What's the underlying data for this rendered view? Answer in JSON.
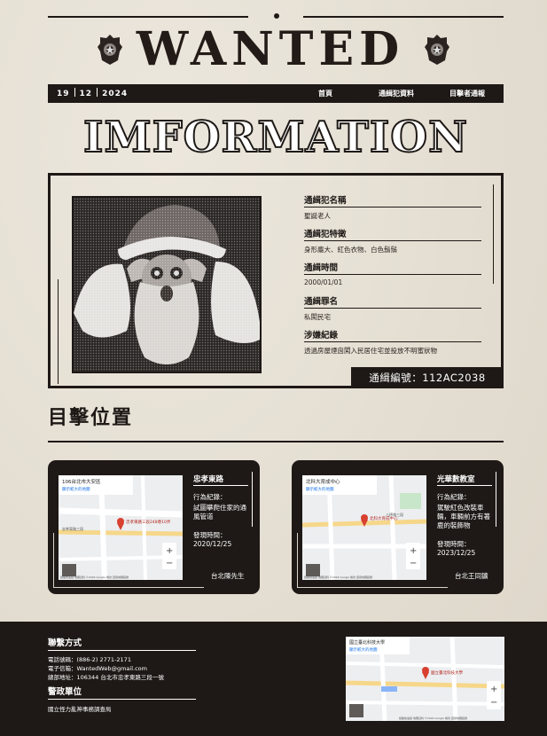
{
  "header": {
    "title": "WANTED",
    "date": {
      "day": "19",
      "month": "12",
      "year": "2024"
    },
    "nav": [
      {
        "label": "首頁"
      },
      {
        "label": "通緝犯資料"
      },
      {
        "label": "目擊者通報"
      }
    ],
    "banner": "IMFORMATION"
  },
  "profile": {
    "fields": [
      {
        "label": "通緝犯名稱",
        "value": "聖誕老人"
      },
      {
        "label": "通緝犯特徵",
        "value": "身形龐大、紅色衣物、白色鬍鬚"
      },
      {
        "label": "通緝時間",
        "value": "2000/01/01"
      },
      {
        "label": "通緝罪名",
        "value": "私闖民宅"
      },
      {
        "label": "涉嫌紀錄",
        "value": "透過房屋煙囪闖入民居住宅並投放不明蜜狀物"
      }
    ],
    "wanted_number": "通緝編號：112AC2038"
  },
  "sightings": {
    "title": "目擊位置",
    "cards": [
      {
        "location": "忠孝東路",
        "record_label": "行為紀錄：",
        "record": "試圖攀爬住家的通風管道",
        "time_label": "發現時間：",
        "time": "2020/12/25",
        "reporter": "台北陳先生",
        "map_label": "忠孝東路三段248巷10弄",
        "map_info_title": "106台北市大安區",
        "map_info_link": "顯示較大的地圖",
        "map_street": "忠孝東路三段",
        "map_copyright": "鍵盤快速鍵  地圖資料 ©2024 Google  條款  回報地圖錯誤"
      },
      {
        "location": "光華數教室",
        "record_label": "行為紀錄：",
        "record": "駕駛紅色改裝車輛，車輛前方有著鹿的裝飾物",
        "time_label": "發現時間：",
        "time": "2023/12/25",
        "reporter": "台北王同鑛",
        "map_label": "北科大育成中心",
        "map_info_title": "北科大育成中心",
        "map_info_link": "顯示較大的地圖",
        "map_street": "八德路三段",
        "map_copyright": "鍵盤快速鍵  地圖資料 ©2024 Google  條款  回報地圖錯誤"
      }
    ]
  },
  "footer": {
    "contact_title": "聯繫方式",
    "phone": "電話號碼：(886-2) 2771-2171",
    "email": "電子信箱：WantedWeb@gmail.com",
    "address": "總部地址：106344 台北市忠孝東路三段一號",
    "agency_title": "警政單位",
    "agency": "國立怪力亂神事務調查局",
    "map_info_title": "國立臺北科技大學",
    "map_info_link": "顯示較大的地圖",
    "map_label": "國立臺北科技大學",
    "map_copyright": "鍵盤快速鍵  地圖資料 ©2024 Google  條款  回報地圖錯誤"
  },
  "colors": {
    "ink": "#1e1916",
    "paper": "#e7e1d6",
    "pin": "#d8402f"
  }
}
